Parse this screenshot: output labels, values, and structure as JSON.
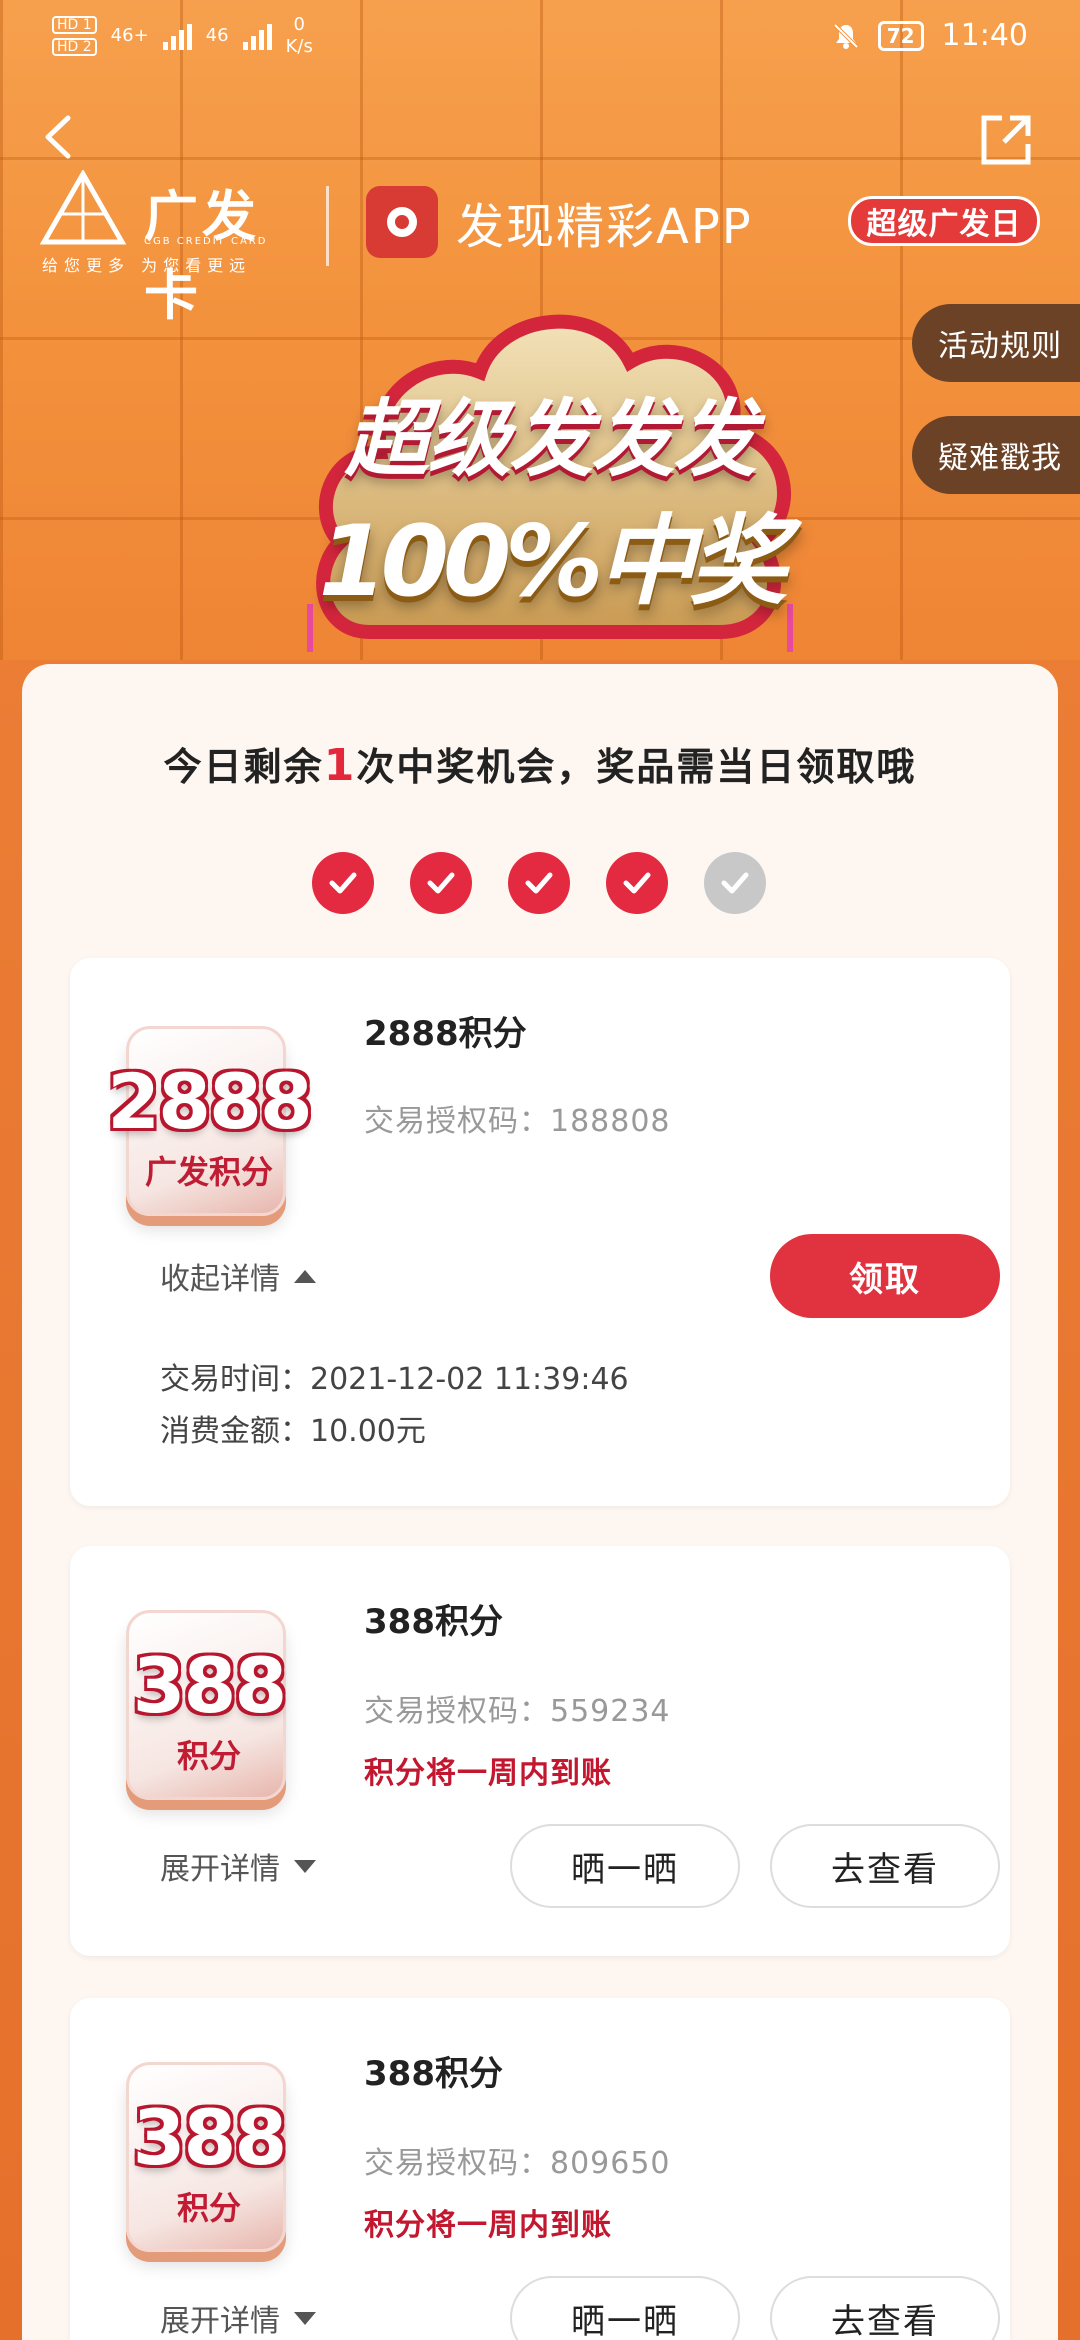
{
  "status_bar": {
    "sim1": "HD 1",
    "sim2": "HD 2",
    "net1": "46+",
    "net2": "46",
    "speed_value": "0",
    "speed_unit": "K/s",
    "battery": "72",
    "time": "11:40"
  },
  "header": {
    "brand_name": "广发卡",
    "brand_sub": "CGB CREDIT CARD",
    "brand_slogan": "给您更多 为您看更远",
    "app_name": "发现精彩APP",
    "event_badge": "超级广发日"
  },
  "side_pills": {
    "rules": "活动规则",
    "help": "疑难戳我"
  },
  "banner": {
    "line1": "超级发发发",
    "line2": "100%中奖"
  },
  "panel": {
    "head_prefix": "今日剩余",
    "head_count": "1",
    "head_suffix": "次中奖机会，奖品需当日领取哦",
    "checks": [
      true,
      true,
      true,
      true,
      false
    ]
  },
  "cards": [
    {
      "thumb_big": "2888",
      "thumb_small": "广发积分",
      "title": "2888积分",
      "auth": "交易授权码：188808",
      "toggle": "收起详情",
      "claim": "领取",
      "trade_time": "交易时间：2021-12-02 11:39:46",
      "amount": "消费金额：10.00元"
    },
    {
      "thumb_big": "388",
      "thumb_small": "积分",
      "title": "388积分",
      "auth": "交易授权码：559234",
      "note": "积分将一周内到账",
      "toggle": "展开详情",
      "share": "晒一晒",
      "view": "去查看"
    },
    {
      "thumb_big": "388",
      "thumb_small": "积分",
      "title": "388积分",
      "auth": "交易授权码：809650",
      "note": "积分将一周内到账",
      "toggle": "展开详情",
      "share": "晒一晒",
      "view": "去查看"
    }
  ],
  "colors": {
    "accent_red": "#e0333f",
    "panel_bg": "#fdf6f1",
    "hero_orange": "#f3923d",
    "pill_brown": "#6b4226"
  }
}
